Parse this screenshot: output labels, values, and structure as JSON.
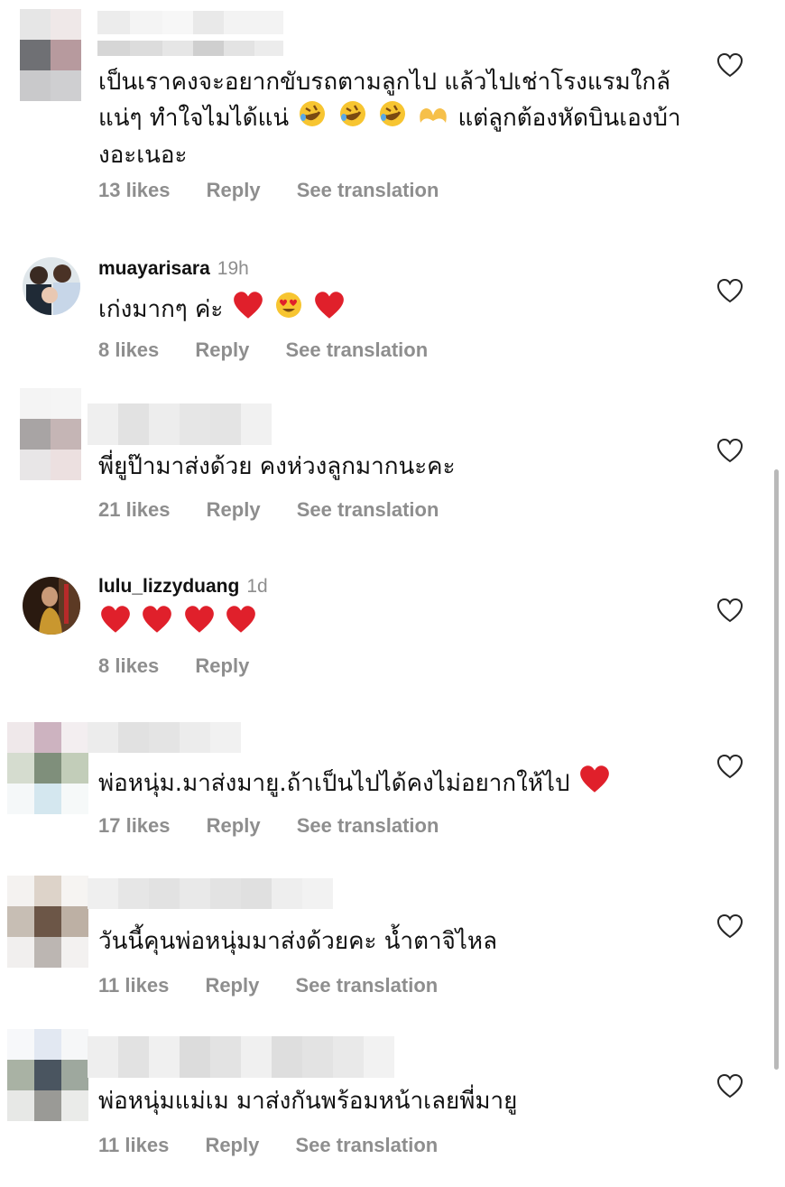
{
  "comments": [
    {
      "username": "",
      "time": "",
      "avatar_blurred": true,
      "text": "เป็นเราคงจะอยากขับรถตามลูกไป แล้วไปเช่าโรงแรมใกล้แน่ๆ ทำใจไมได้แน่",
      "text_tail": "แต่ลูกต้องหัดบินเองบ้างอะเนอะ",
      "likes": "13 likes",
      "reply": "Reply",
      "translate": "See translation"
    },
    {
      "username": "muayarisara",
      "time": "19h",
      "avatar_blurred": false,
      "text": "เก่งมากๆ ค่ะ",
      "likes": "8 likes",
      "reply": "Reply",
      "translate": "See translation"
    },
    {
      "username": "",
      "time": "",
      "avatar_blurred": true,
      "text": "พี่ยูป๊ามาส่งด้วย คงห่วงลูกมากนะคะ",
      "likes": "21 likes",
      "reply": "Reply",
      "translate": "See translation"
    },
    {
      "username": "lulu_lizzyduang",
      "time": "1d",
      "avatar_blurred": false,
      "text": "",
      "likes": "8 likes",
      "reply": "Reply",
      "translate": ""
    },
    {
      "username": "",
      "time": "",
      "avatar_blurred": true,
      "text": "พ่อหนุ่ม.มาส่งมายู.ถ้าเป็นไปได้คงไม่อยากให้ไป",
      "likes": "17 likes",
      "reply": "Reply",
      "translate": "See translation"
    },
    {
      "username": "",
      "time": "",
      "avatar_blurred": true,
      "text": "วันนี้คุนพ่อหนุ่มมาส่งด้วยคะ น้ำตาจิไหล",
      "likes": "11 likes",
      "reply": "Reply",
      "translate": "See translation"
    },
    {
      "username": "",
      "time": "",
      "avatar_blurred": true,
      "text": "พ่อหนุ่มแม่เม มาส่งกันพร้อมหน้าเลยพี่มายู",
      "likes": "11 likes",
      "reply": "Reply",
      "translate": "See translation"
    }
  ],
  "icons": {
    "like": "heart-outline-icon",
    "emoji_laugh": "rolling-on-floor-laughing-emoji",
    "emoji_heart_hands": "heart-hands-emoji",
    "emoji_red_heart": "red-heart-emoji",
    "emoji_heart_eyes": "heart-eyes-emoji"
  },
  "colors": {
    "secondary_text": "#8e8e8e",
    "primary_text": "#111111",
    "heart_red": "#e0202b"
  }
}
